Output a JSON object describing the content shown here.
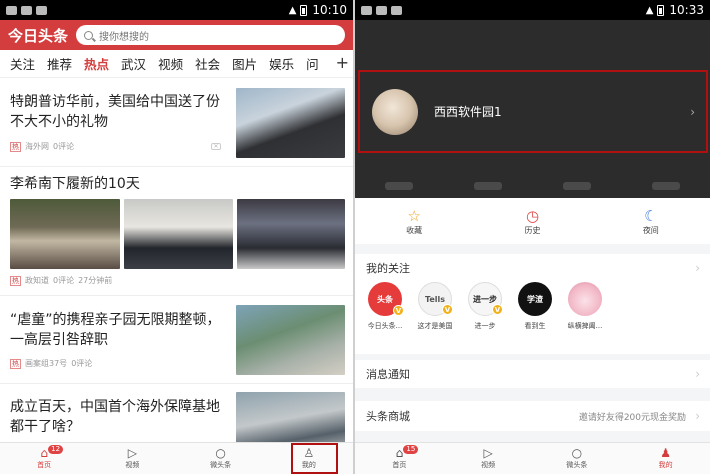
{
  "left": {
    "status_time": "10:10",
    "logo": "今日头条",
    "search_placeholder": "搜你想搜的",
    "channels": [
      "关注",
      "推荐",
      "热点",
      "武汉",
      "视频",
      "社会",
      "图片",
      "娱乐",
      "问"
    ],
    "active_channel": 2,
    "articles": [
      {
        "title": "特朗普访华前，美国给中国送了份不大不小的礼物",
        "source": "海外网",
        "comments": "0评论",
        "tag": "热"
      },
      {
        "title": "李希南下履新的10天",
        "source": "政知道",
        "comments": "0评论",
        "time": "27分钟前",
        "tag": "热"
      },
      {
        "title": "“虐童”的携程亲子园无限期整顿，一高层引咎辞职",
        "source": "画案组37号",
        "comments": "0评论",
        "tag": "热"
      },
      {
        "title": "成立百天，中国首个海外保障基地都干了啥？"
      }
    ],
    "tabs": [
      {
        "label": "首页",
        "badge": "12"
      },
      {
        "label": "视频"
      },
      {
        "label": "微头条"
      },
      {
        "label": "我的"
      }
    ]
  },
  "right": {
    "status_time": "10:33",
    "profile_name": "西西软件园1",
    "quick": [
      "收藏",
      "历史",
      "夜间"
    ],
    "follow_title": "我的关注",
    "follows": [
      {
        "name": "今日头条...",
        "text": "头条"
      },
      {
        "name": "这才是美国",
        "text": "Tells"
      },
      {
        "name": "进一步",
        "text": "进一步"
      },
      {
        "name": "看到生",
        "text": "学渣"
      },
      {
        "name": "纵横捭阖...",
        "text": ""
      }
    ],
    "notify": "消息通知",
    "shop": "头条商城",
    "shop_hint": "邀请好友得200元现金奖励",
    "tabs": [
      {
        "label": "首页",
        "badge": "15"
      },
      {
        "label": "视频"
      },
      {
        "label": "微头条"
      },
      {
        "label": "我的"
      }
    ]
  },
  "colors": {
    "brand_red": "#d43d3d",
    "highlight_box": "#b01010",
    "follow_verified": "#f2b019"
  },
  "icons": {
    "wifi": "wifi-icon",
    "search": "search-icon",
    "close": "close-icon",
    "star": "star-icon",
    "clock": "history-icon",
    "moon": "moon-icon",
    "home": "home-icon",
    "play": "play-icon",
    "chat": "chat-icon",
    "person": "person-icon"
  }
}
